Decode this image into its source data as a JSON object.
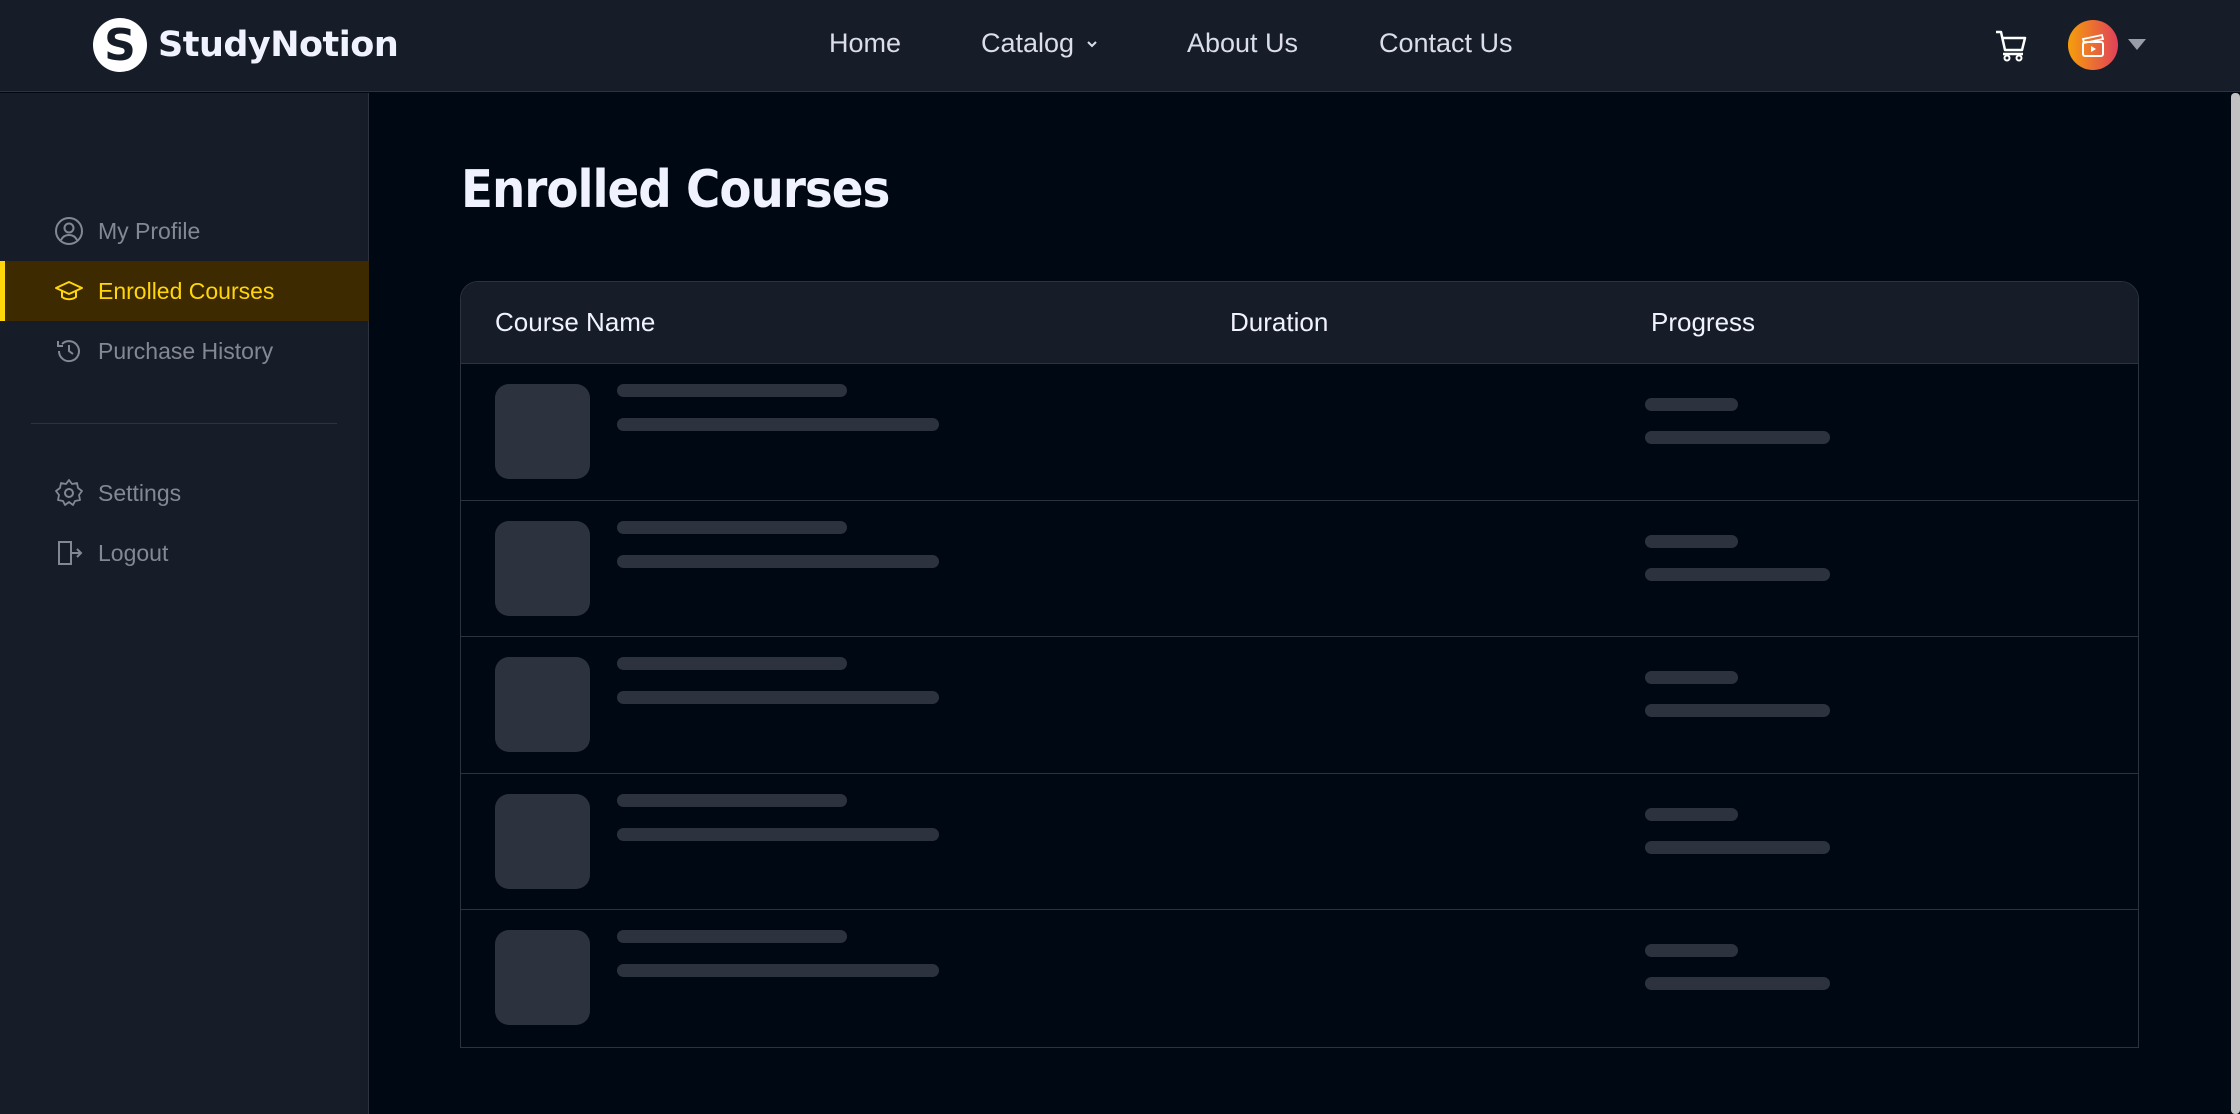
{
  "header": {
    "logo_letter": "S",
    "logo_text": "StudyNotion",
    "nav": [
      "Home",
      "Catalog",
      "About Us",
      "Contact Us"
    ]
  },
  "sidebar": {
    "items": [
      "My Profile",
      "Enrolled Courses",
      "Purchase History"
    ],
    "settings": "Settings",
    "logout": "Logout"
  },
  "main": {
    "title": "Enrolled Courses",
    "columns": [
      "Course Name",
      "Duration",
      "Progress"
    ],
    "loading_rows": 5
  },
  "colors": {
    "accent": "#ffd60a",
    "active_bg": "#3d2a01",
    "skeleton": "#2c333f"
  }
}
